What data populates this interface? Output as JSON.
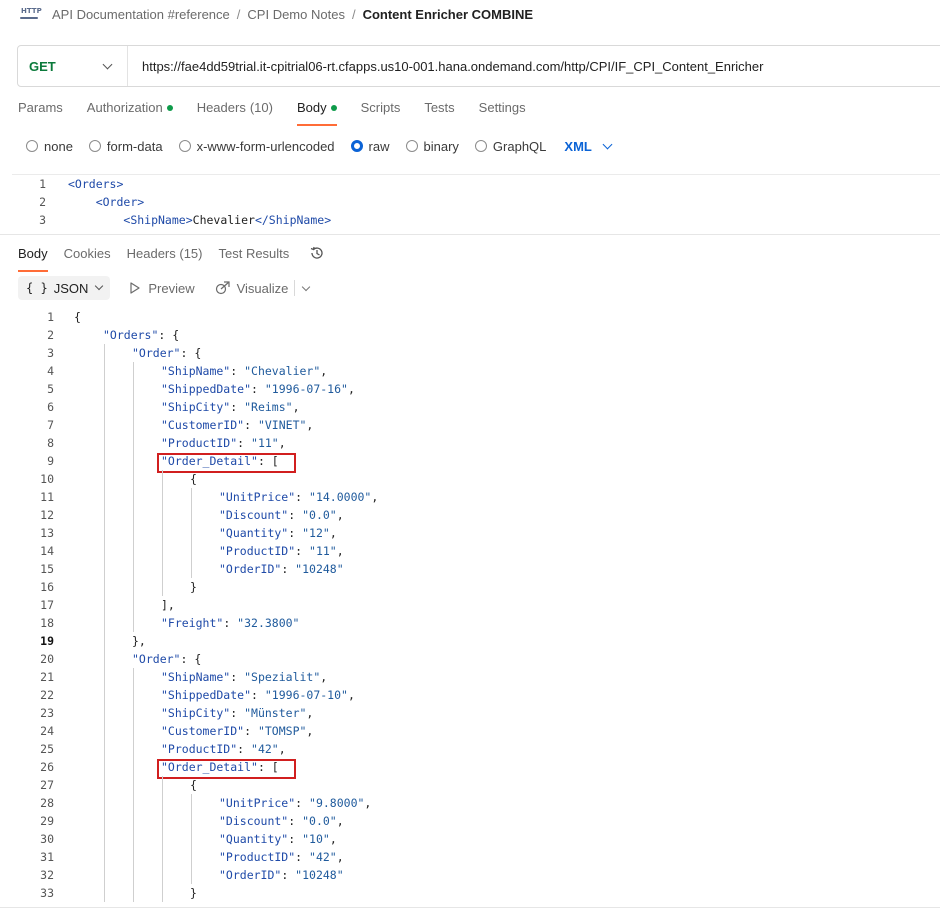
{
  "breadcrumb": {
    "icon": "http-request-icon",
    "icon_text": "HTTP",
    "items": [
      "API Documentation #reference",
      "CPI Demo Notes"
    ],
    "separator": "/",
    "current": "Content Enricher COMBINE"
  },
  "request": {
    "method": "GET",
    "url": "https://fae4dd59trial.it-cpitrial06-rt.cfapps.us10-001.hana.ondemand.com/http/CPI/IF_CPI_Content_Enricher"
  },
  "request_tabs": [
    {
      "label": "Params",
      "count": "",
      "dot": false,
      "active": false
    },
    {
      "label": "Authorization",
      "count": "",
      "dot": true,
      "active": false
    },
    {
      "label": "Headers",
      "count": "(10)",
      "dot": false,
      "active": false
    },
    {
      "label": "Body",
      "count": "",
      "dot": true,
      "active": true
    },
    {
      "label": "Scripts",
      "count": "",
      "dot": false,
      "active": false
    },
    {
      "label": "Tests",
      "count": "",
      "dot": false,
      "active": false
    },
    {
      "label": "Settings",
      "count": "",
      "dot": false,
      "active": false
    }
  ],
  "body_types": {
    "options": [
      "none",
      "form-data",
      "x-www-form-urlencoded",
      "raw",
      "binary",
      "GraphQL"
    ],
    "selected": "raw",
    "language": "XML"
  },
  "request_body_lines": [
    {
      "num": "1",
      "indent": "",
      "tag_open": "<Orders>",
      "text": "",
      "tag_close": ""
    },
    {
      "num": "2",
      "indent": "    ",
      "tag_open": "<Order>",
      "text": "",
      "tag_close": ""
    },
    {
      "num": "3",
      "indent": "        ",
      "tag_open": "<ShipName>",
      "text": "Chevalier",
      "tag_close": "</ShipName>"
    }
  ],
  "response_tabs": [
    {
      "label": "Body",
      "active": true
    },
    {
      "label": "Cookies",
      "active": false
    },
    {
      "label": "Headers (15)",
      "active": false
    },
    {
      "label": "Test Results",
      "active": false
    }
  ],
  "response_toolbar": {
    "format_icon_text": "{ }",
    "format": "JSON",
    "preview": "Preview",
    "visualize": "Visualize"
  },
  "response_lines": [
    {
      "n": "1",
      "d": 0,
      "k": "",
      "v": "",
      "p": "{"
    },
    {
      "n": "2",
      "d": 1,
      "k": "\"Orders\"",
      "v": "",
      "p": ": {"
    },
    {
      "n": "3",
      "d": 2,
      "k": "\"Order\"",
      "v": "",
      "p": ": {"
    },
    {
      "n": "4",
      "d": 3,
      "k": "\"ShipName\"",
      "v": "\"Chevalier\"",
      "p": ","
    },
    {
      "n": "5",
      "d": 3,
      "k": "\"ShippedDate\"",
      "v": "\"1996-07-16\"",
      "p": ","
    },
    {
      "n": "6",
      "d": 3,
      "k": "\"ShipCity\"",
      "v": "\"Reims\"",
      "p": ","
    },
    {
      "n": "7",
      "d": 3,
      "k": "\"CustomerID\"",
      "v": "\"VINET\"",
      "p": ","
    },
    {
      "n": "8",
      "d": 3,
      "k": "\"ProductID\"",
      "v": "\"11\"",
      "p": ","
    },
    {
      "n": "9",
      "d": 3,
      "k": "\"Order_Detail\"",
      "v": "",
      "p": ": [",
      "hl": true
    },
    {
      "n": "10",
      "d": 4,
      "k": "",
      "v": "",
      "p": "{"
    },
    {
      "n": "11",
      "d": 5,
      "k": "\"UnitPrice\"",
      "v": "\"14.0000\"",
      "p": ","
    },
    {
      "n": "12",
      "d": 5,
      "k": "\"Discount\"",
      "v": "\"0.0\"",
      "p": ","
    },
    {
      "n": "13",
      "d": 5,
      "k": "\"Quantity\"",
      "v": "\"12\"",
      "p": ","
    },
    {
      "n": "14",
      "d": 5,
      "k": "\"ProductID\"",
      "v": "\"11\"",
      "p": ","
    },
    {
      "n": "15",
      "d": 5,
      "k": "\"OrderID\"",
      "v": "\"10248\"",
      "p": ""
    },
    {
      "n": "16",
      "d": 4,
      "k": "",
      "v": "",
      "p": "}"
    },
    {
      "n": "17",
      "d": 3,
      "k": "",
      "v": "",
      "p": "],"
    },
    {
      "n": "18",
      "d": 3,
      "k": "\"Freight\"",
      "v": "\"32.3800\"",
      "p": ""
    },
    {
      "n": "19",
      "d": 2,
      "k": "",
      "v": "",
      "p": "},",
      "cur": true
    },
    {
      "n": "20",
      "d": 2,
      "k": "\"Order\"",
      "v": "",
      "p": ": {"
    },
    {
      "n": "21",
      "d": 3,
      "k": "\"ShipName\"",
      "v": "\"Spezialit\"",
      "p": ","
    },
    {
      "n": "22",
      "d": 3,
      "k": "\"ShippedDate\"",
      "v": "\"1996-07-10\"",
      "p": ","
    },
    {
      "n": "23",
      "d": 3,
      "k": "\"ShipCity\"",
      "v": "\"Münster\"",
      "p": ","
    },
    {
      "n": "24",
      "d": 3,
      "k": "\"CustomerID\"",
      "v": "\"TOMSP\"",
      "p": ","
    },
    {
      "n": "25",
      "d": 3,
      "k": "\"ProductID\"",
      "v": "\"42\"",
      "p": ","
    },
    {
      "n": "26",
      "d": 3,
      "k": "\"Order_Detail\"",
      "v": "",
      "p": ": [",
      "hl": true
    },
    {
      "n": "27",
      "d": 4,
      "k": "",
      "v": "",
      "p": "{"
    },
    {
      "n": "28",
      "d": 5,
      "k": "\"UnitPrice\"",
      "v": "\"9.8000\"",
      "p": ","
    },
    {
      "n": "29",
      "d": 5,
      "k": "\"Discount\"",
      "v": "\"0.0\"",
      "p": ","
    },
    {
      "n": "30",
      "d": 5,
      "k": "\"Quantity\"",
      "v": "\"10\"",
      "p": ","
    },
    {
      "n": "31",
      "d": 5,
      "k": "\"ProductID\"",
      "v": "\"42\"",
      "p": ","
    },
    {
      "n": "32",
      "d": 5,
      "k": "\"OrderID\"",
      "v": "\"10248\"",
      "p": ""
    },
    {
      "n": "33",
      "d": 4,
      "k": "",
      "v": "",
      "p": "}"
    }
  ],
  "colors": {
    "accent_tab": "#ff6c37",
    "method_get": "#0b7a3b",
    "link_blue": "#0b63d6",
    "status_dot": "#0e9b4a",
    "highlight_box": "#d11f1f"
  }
}
